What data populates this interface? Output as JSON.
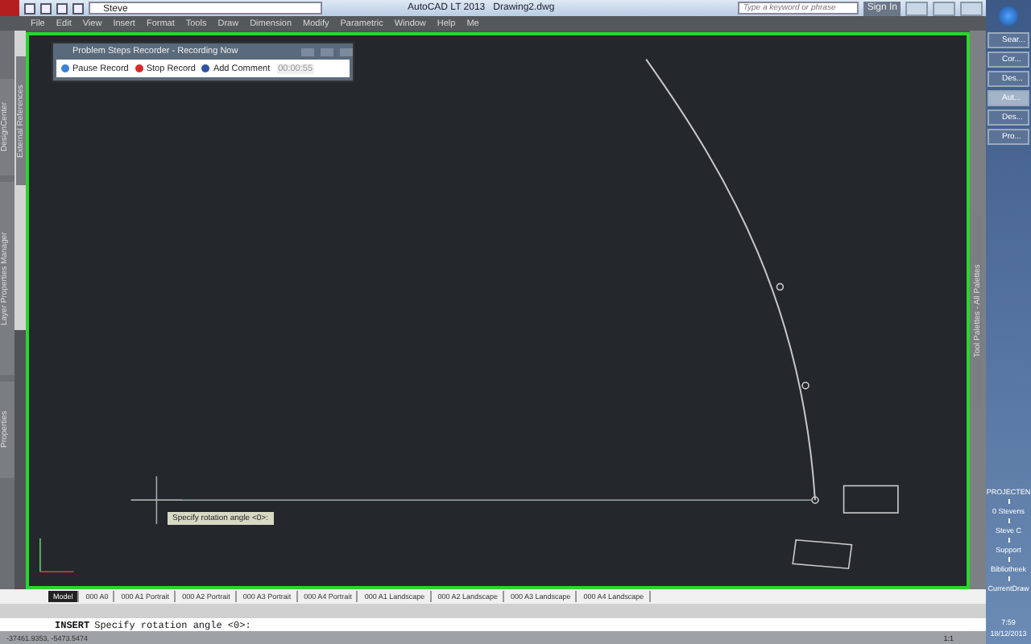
{
  "title_bar": {
    "workspace": "Steve",
    "app_title": "AutoCAD LT 2013",
    "document": "Drawing2.dwg",
    "search": {
      "placeholder": "Type a keyword or phrase"
    },
    "sign_in": "Sign In"
  },
  "menu": [
    "File",
    "Edit",
    "View",
    "Insert",
    "Format",
    "Tools",
    "Draw",
    "Dimension",
    "Modify",
    "Parametric",
    "Window",
    "Help",
    "Me"
  ],
  "left_palettes": [
    "DesignCenter",
    "Layer Properties Manager",
    "Properties"
  ],
  "xref_palette": "External References",
  "recorder": {
    "title": "Problem Steps Recorder - Recording Now",
    "buttons": [
      {
        "kind": "pause",
        "label": "Pause Record"
      },
      {
        "kind": "stop",
        "label": "Stop Record"
      },
      {
        "kind": "comment",
        "label": "Add Comment"
      }
    ],
    "timer": "00:00:55"
  },
  "tooltip": "Specify rotation angle <0>:",
  "right_palette": "Tool Palettes - All Palettes",
  "layout_tabs": [
    {
      "label": "Model",
      "selected": true
    },
    {
      "label": "000 A0",
      "selected": false
    },
    {
      "label": "000 A1 Portrait",
      "selected": false
    },
    {
      "label": "000 A2 Portrait",
      "selected": false
    },
    {
      "label": "000 A3 Portrait",
      "selected": false
    },
    {
      "label": "000 A4 Portrait",
      "selected": false
    },
    {
      "label": "000 A1 Landscape",
      "selected": false
    },
    {
      "label": "000 A2 Landscape",
      "selected": false
    },
    {
      "label": "000 A3 Landscape",
      "selected": false
    },
    {
      "label": "000 A4 Landscape",
      "selected": false
    }
  ],
  "command_line": {
    "command": "INSERT",
    "prompt": "Specify rotation angle <0>:"
  },
  "status_bar": {
    "coordinates": "-37461.9353, -5473.5474",
    "scale": "1:1"
  },
  "taskbar": {
    "items": [
      {
        "label": "Sear...",
        "selected": false
      },
      {
        "label": "Cor...",
        "selected": false
      },
      {
        "label": "Des...",
        "selected": false
      },
      {
        "label": "Aut...",
        "selected": true
      },
      {
        "label": "Des...",
        "selected": false
      },
      {
        "label": "Pro...",
        "selected": false
      }
    ],
    "toolbar_items": [
      "PROJECTEN",
      "0 Stevens",
      "Steve C",
      "Support",
      "Bibliotheek",
      "CurrentDraw"
    ],
    "time": "7:59",
    "date": "18/12/2013"
  }
}
